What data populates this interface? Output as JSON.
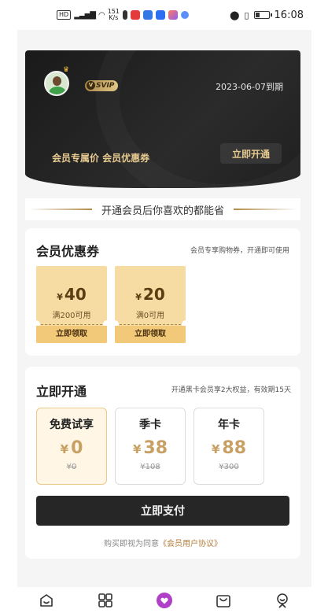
{
  "status_bar": {
    "hd_label": "HD",
    "network": "4G",
    "speed_value": "151",
    "speed_unit": "K/s",
    "time": "16:08"
  },
  "hero": {
    "svip_label": "SVIP",
    "expire_text": "2023-06-07到期",
    "tags_text": "会员专属价 会员优惠券",
    "open_button": "立即开通"
  },
  "slogan": "开通会员后你喜欢的都能省",
  "coupons": {
    "title": "会员优惠券",
    "subtitle": "会员专享购物券，开通即可使用",
    "items": [
      {
        "currency": "¥",
        "amount": "40",
        "condition": "满200可用",
        "action": "立即领取"
      },
      {
        "currency": "¥",
        "amount": "20",
        "condition": "满0可用",
        "action": "立即领取"
      }
    ]
  },
  "open": {
    "title": "立即开通",
    "subtitle": "开通黑卡会员享2大权益，有效期15天",
    "plans": [
      {
        "name": "免费试享",
        "currency": "¥",
        "price": "0",
        "original": "¥0",
        "selected": true
      },
      {
        "name": "季卡",
        "currency": "¥",
        "price": "38",
        "original": "¥108",
        "selected": false
      },
      {
        "name": "年卡",
        "currency": "¥",
        "price": "88",
        "original": "¥300",
        "selected": false
      }
    ],
    "pay_button": "立即支付",
    "agreement_prefix": "购买即视为同意",
    "agreement_link": "《会员用户协议》"
  },
  "nav": {
    "items": [
      {
        "icon": "home-icon"
      },
      {
        "icon": "grid-icon"
      },
      {
        "icon": "heart-icon",
        "active": true
      },
      {
        "icon": "cart-icon"
      },
      {
        "icon": "profile-icon"
      }
    ]
  },
  "colors": {
    "gold": "#c9a063",
    "dark": "#262626",
    "coupon": "#f6dca2",
    "nav_active": "#b040c8"
  }
}
